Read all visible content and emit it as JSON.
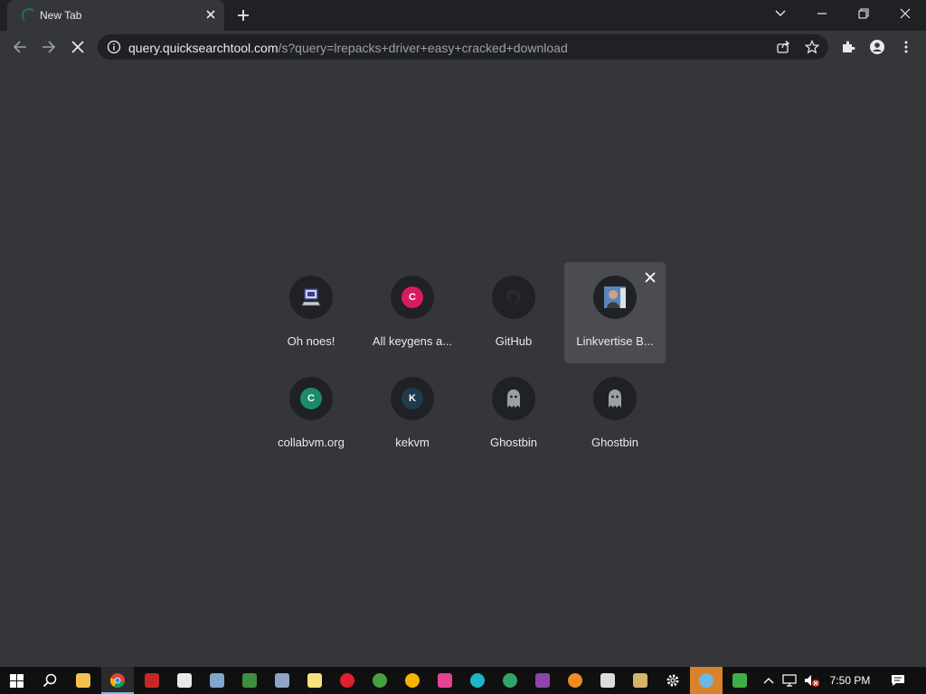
{
  "browser": {
    "tab_title": "New Tab",
    "url_host": "query.quicksearchtool.com",
    "url_rest": "/s?query=lrepacks+driver+easy+cracked+download"
  },
  "shortcuts": [
    {
      "label": "Oh noes!",
      "icon": "pc-computer-icon"
    },
    {
      "label": "All keygens a...",
      "icon": "letter-badge",
      "letter": "C",
      "color": "#d81b60"
    },
    {
      "label": "GitHub",
      "icon": "github-icon"
    },
    {
      "label": "Linkvertise B...",
      "icon": "avatar-photo-icon",
      "hovered": true
    },
    {
      "label": "collabvm.org",
      "icon": "letter-badge",
      "letter": "C",
      "color": "#1b8a6b"
    },
    {
      "label": "kekvm",
      "icon": "letter-badge",
      "letter": "K",
      "color": "#1f3b4d"
    },
    {
      "label": "Ghostbin",
      "icon": "ghost-icon"
    },
    {
      "label": "Ghostbin",
      "icon": "ghost-icon"
    }
  ],
  "taskbar": {
    "clock": "7:50 PM"
  },
  "colors": {
    "page_bg": "#35363a",
    "tabbar_bg": "#202124",
    "accent": "#76b9ed"
  }
}
